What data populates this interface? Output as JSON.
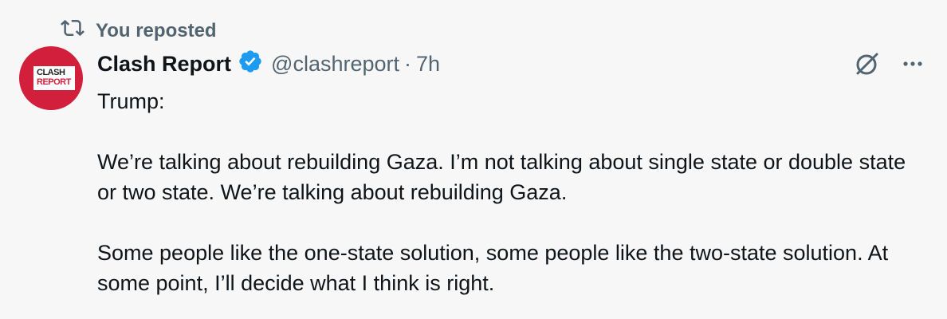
{
  "repost": {
    "label": "You reposted",
    "icon": "repost-icon"
  },
  "author": {
    "avatar_text_line1": "CLASH",
    "avatar_text_line2": "REPORT",
    "name": "Clash Report",
    "handle": "@clashreport",
    "separator": "·",
    "time": "7h",
    "verified_icon": "verified-badge-icon"
  },
  "actions": {
    "grok_icon": "grok-icon",
    "more_icon": "more-icon"
  },
  "tweet": {
    "line1": "Trump:",
    "para1": "We’re talking about rebuilding Gaza. I’m not talking about single state or double state or two state. We’re talking about rebuilding Gaza.",
    "para2": "Some people like the one-state solution, some people like the two-state solution. At some point, I’ll decide what I think is right."
  },
  "colors": {
    "text": "#0f1419",
    "secondary": "#536471",
    "verified": "#1d9bf0",
    "avatar_bg": "#d21f3c",
    "background": "#f7f7f7"
  }
}
